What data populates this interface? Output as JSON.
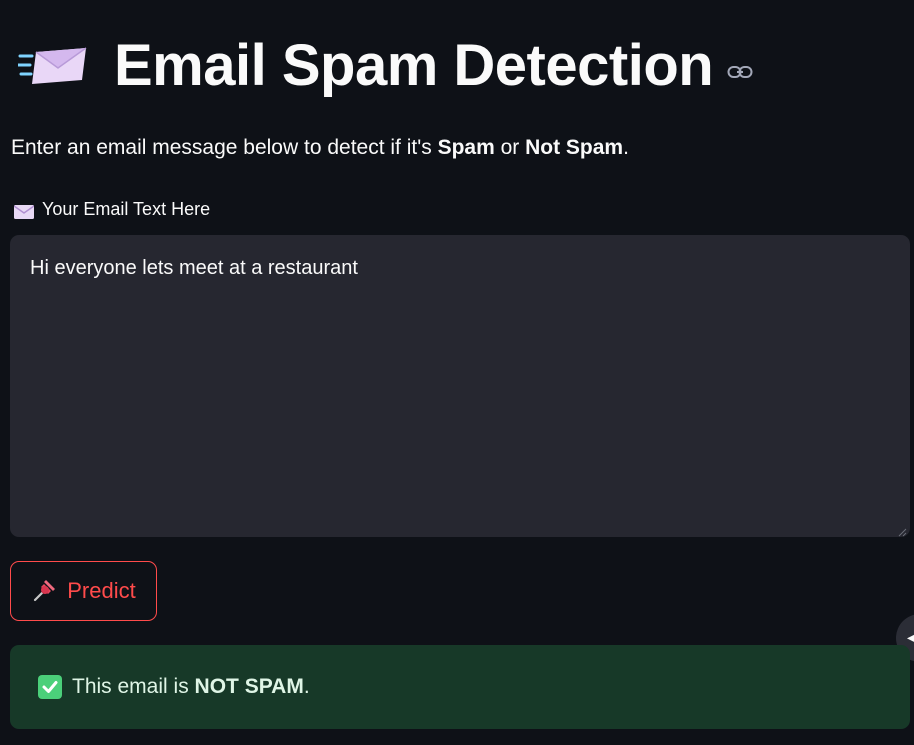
{
  "header": {
    "title": "Email Spam Detection",
    "title_icon": "envelope-with-speed-lines-icon",
    "anchor_icon": "link-icon"
  },
  "intro": {
    "prefix": "Enter an email message below to detect if it's ",
    "spam": "Spam",
    "middle": " or ",
    "not_spam": "Not Spam",
    "suffix": "."
  },
  "input": {
    "label": "Your Email Text Here",
    "label_icon": "envelope-icon",
    "value": "Hi everyone lets meet at a restaurant"
  },
  "predict_button": {
    "icon": "pushpin-icon",
    "label": "Predict"
  },
  "result": {
    "icon": "check-mark-button-icon",
    "prefix": "This email is ",
    "verdict": "NOT SPAM",
    "suffix": "."
  },
  "colors": {
    "background": "#0e1117",
    "input_bg": "#262730",
    "accent": "#ff4b4b",
    "success_bg": "#173928",
    "success_text": "#dff5e6"
  }
}
